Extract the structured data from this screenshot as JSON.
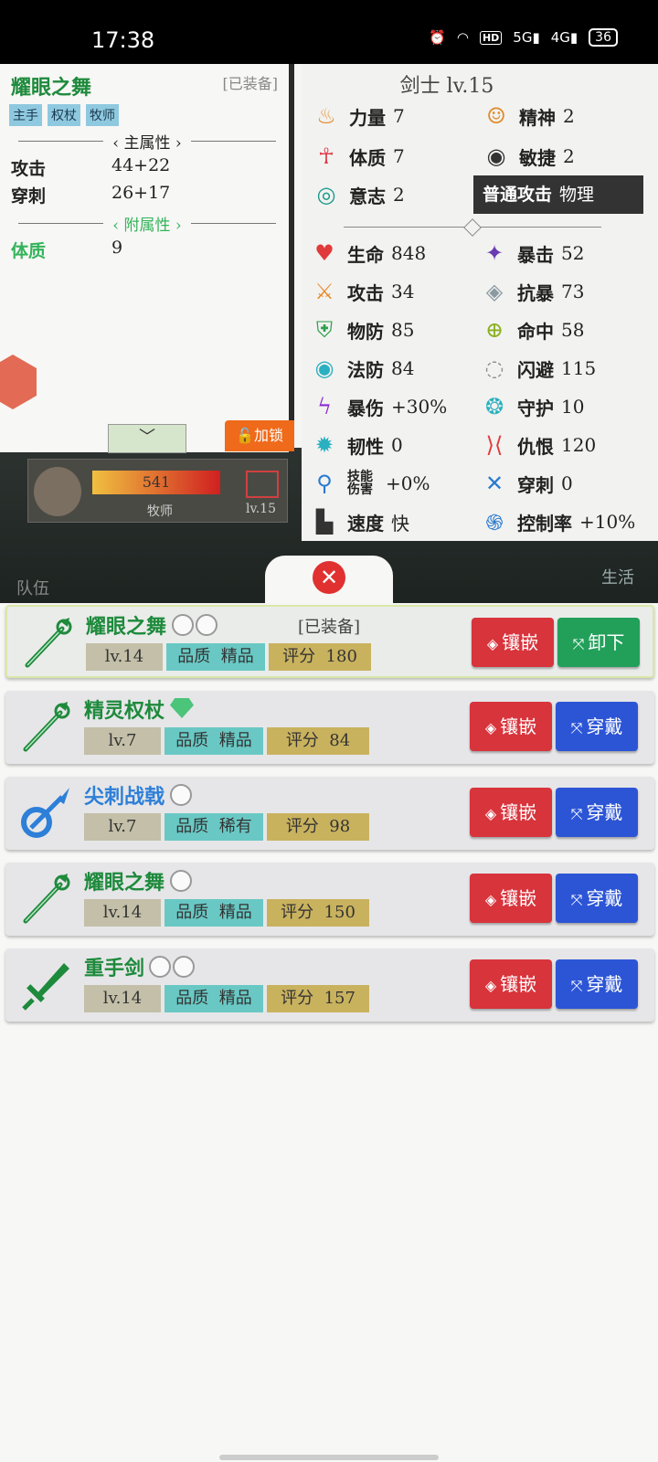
{
  "status_bar": {
    "time": "17:38",
    "signal_5g": "5G",
    "signal_4g": "4G",
    "hd": "HD",
    "battery": "36"
  },
  "scene": {
    "hp_bar": "541",
    "class": "牧师",
    "level": "lv.15",
    "left_label": "队伍",
    "right_label": "生活"
  },
  "detail": {
    "name": "耀眼之舞",
    "equipped": "[已装备]",
    "tags": [
      "主手",
      "权杖",
      "牧师"
    ],
    "main_header": "主属性",
    "main_attrs": [
      {
        "k": "攻击",
        "v": "44+22"
      },
      {
        "k": "穿刺",
        "v": "26+17"
      }
    ],
    "sub_header": "附属性",
    "sub_attrs": [
      {
        "k": "体质",
        "v": "9"
      }
    ],
    "expand": "﹀",
    "lock": "加锁"
  },
  "stats": {
    "title": "剑士  lv.15",
    "base": [
      {
        "k": "力量",
        "v": "7",
        "icon": "flame-icon",
        "glyph": "♨",
        "color": "#e08a2a"
      },
      {
        "k": "精神",
        "v": "2",
        "icon": "head-icon",
        "glyph": "☺",
        "color": "#e08a2a"
      },
      {
        "k": "体质",
        "v": "7",
        "icon": "body-icon",
        "glyph": "☥",
        "color": "#e03a4a"
      },
      {
        "k": "敏捷",
        "v": "2",
        "icon": "eye-icon",
        "glyph": "◉",
        "color": "#333333"
      },
      {
        "k": "意志",
        "v": "2",
        "icon": "will-icon",
        "glyph": "◎",
        "color": "#1a9a8a"
      }
    ],
    "attack_type": {
      "label": "普通攻击",
      "value": "物理"
    },
    "combat": [
      {
        "k": "生命",
        "v": "848",
        "icon": "heart-icon",
        "glyph": "♥",
        "color": "#e03a3a"
      },
      {
        "k": "暴击",
        "v": "52",
        "icon": "crit-icon",
        "glyph": "✦",
        "color": "#6a3ab0"
      },
      {
        "k": "攻击",
        "v": "34",
        "icon": "sword-icon",
        "glyph": "⚔",
        "color": "#e88a2a"
      },
      {
        "k": "抗暴",
        "v": "73",
        "icon": "anti-crit-icon",
        "glyph": "◈",
        "color": "#8a9aa0"
      },
      {
        "k": "物防",
        "v": "85",
        "icon": "shield-icon",
        "glyph": "⛨",
        "color": "#2aa04a"
      },
      {
        "k": "命中",
        "v": "58",
        "icon": "crosshair-icon",
        "glyph": "⊕",
        "color": "#8ab020"
      },
      {
        "k": "法防",
        "v": "84",
        "icon": "magic-defense-icon",
        "glyph": "◉",
        "color": "#2ab0c0"
      },
      {
        "k": "闪避",
        "v": "115",
        "icon": "dodge-icon",
        "glyph": "◌",
        "color": "#8a8a8a"
      },
      {
        "k": "暴伤",
        "v": "+30%",
        "icon": "lightning-icon",
        "glyph": "ϟ",
        "color": "#8a2ad0"
      },
      {
        "k": "守护",
        "v": "10",
        "icon": "guard-icon",
        "glyph": "❂",
        "color": "#2ab0c0"
      },
      {
        "k": "韧性",
        "v": "0",
        "icon": "tenacity-icon",
        "glyph": "✹",
        "color": "#2ab0c0"
      },
      {
        "k": "仇恨",
        "v": "120",
        "icon": "hate-icon",
        "glyph": "⟩⟨",
        "color": "#e03a3a"
      },
      {
        "k": "技能伤害",
        "v": "+0%",
        "icon": "skill-damage-icon",
        "glyph": "⚲",
        "color": "#2a7ad0"
      },
      {
        "k": "穿刺",
        "v": "0",
        "icon": "pierce-icon",
        "glyph": "✕",
        "color": "#2a7ad0"
      },
      {
        "k": "速度",
        "v": "快",
        "icon": "boot-icon",
        "glyph": "▙",
        "color": "#333333"
      },
      {
        "k": "控制率",
        "v": "+10%",
        "icon": "control-icon",
        "glyph": "֍",
        "color": "#2a7ad0"
      }
    ]
  },
  "close": "✕",
  "items": [
    {
      "name": "耀眼之舞",
      "color": "green",
      "gems": 2,
      "gem_type": "slot",
      "equipped": "[已装备]",
      "level": "lv.14",
      "quality_label": "品质",
      "quality": "精品",
      "score_label": "评分",
      "score": "180",
      "inlay": "镶嵌",
      "action": "卸下",
      "weapon": "staff"
    },
    {
      "name": "精灵权杖",
      "color": "green",
      "gems": 1,
      "gem_type": "green",
      "equipped": "",
      "level": "lv.7",
      "quality_label": "品质",
      "quality": "精品",
      "score_label": "评分",
      "score": "84",
      "inlay": "镶嵌",
      "action": "穿戴",
      "weapon": "staff"
    },
    {
      "name": "尖刺战戟",
      "color": "blue",
      "gems": 1,
      "gem_type": "slot",
      "equipped": "",
      "level": "lv.7",
      "quality_label": "品质",
      "quality": "稀有",
      "score_label": "评分",
      "score": "98",
      "inlay": "镶嵌",
      "action": "穿戴",
      "weapon": "halberd"
    },
    {
      "name": "耀眼之舞",
      "color": "green",
      "gems": 1,
      "gem_type": "slot",
      "equipped": "",
      "level": "lv.14",
      "quality_label": "品质",
      "quality": "精品",
      "score_label": "评分",
      "score": "150",
      "inlay": "镶嵌",
      "action": "穿戴",
      "weapon": "staff"
    },
    {
      "name": "重手剑",
      "color": "green",
      "gems": 2,
      "gem_type": "slot",
      "equipped": "",
      "level": "lv.14",
      "quality_label": "品质",
      "quality": "精品",
      "score_label": "评分",
      "score": "157",
      "inlay": "镶嵌",
      "action": "穿戴",
      "weapon": "sword"
    }
  ]
}
